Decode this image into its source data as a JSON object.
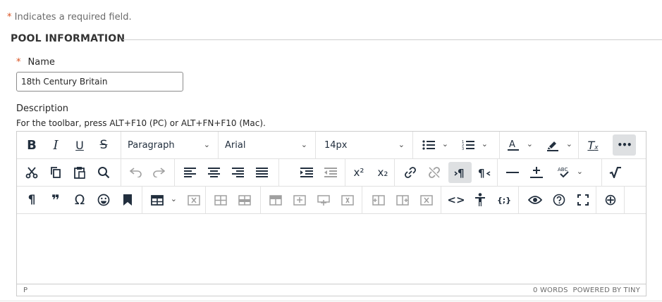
{
  "form": {
    "required_star": "*",
    "required_note": "Indicates a required field."
  },
  "section": {
    "title": "POOL INFORMATION"
  },
  "name_field": {
    "star": "*",
    "label": "Name",
    "value": "18th Century Britain"
  },
  "description": {
    "label": "Description",
    "help": "For the toolbar, press ALT+F10 (PC) or ALT+FN+F10 (Mac)."
  },
  "editor": {
    "toolbar": {
      "bold": "B",
      "italic": "I",
      "underline": "U",
      "strikethrough": "S",
      "block_format": "Paragraph",
      "font_family": "Arial",
      "font_size": "14px",
      "clear_format": "T",
      "more": "•••",
      "superscript": "x²",
      "subscript": "x₂",
      "spellcheck": "ABC",
      "paragraph_mark": "¶",
      "quote": "❞",
      "omega": "Ω",
      "code": "<>",
      "accessibility": "✝",
      "html_code": "{;}",
      "add": "⊕"
    },
    "status": {
      "path": "P",
      "word_count": "0 WORDS",
      "powered_by": "POWERED BY TINY"
    },
    "accent_color": "#222f3e",
    "active_bg": "#dee0e2"
  }
}
